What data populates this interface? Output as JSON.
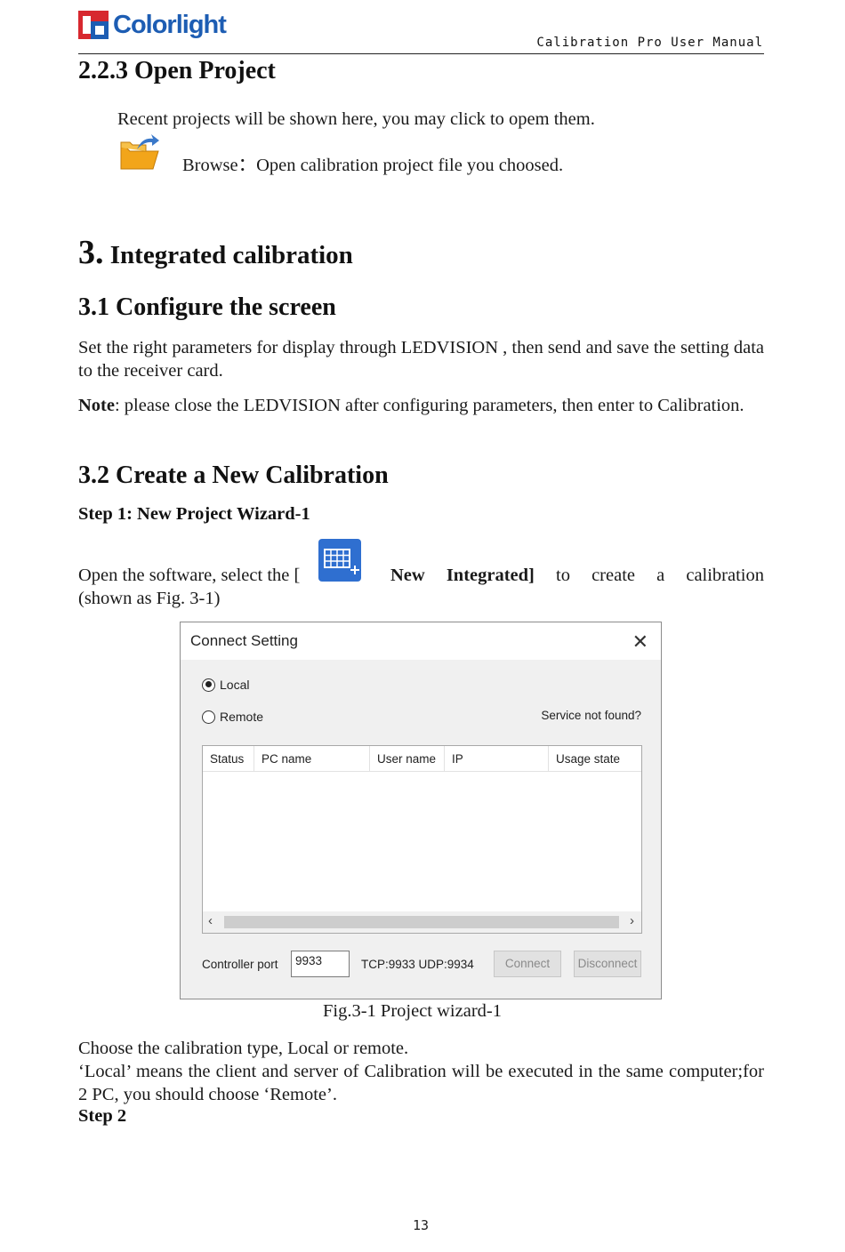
{
  "header": {
    "logo_text": "Colorlight",
    "manual_title": "Calibration Pro User Manual"
  },
  "section_223": {
    "heading": "2.2.3 Open Project",
    "line1": "Recent projects will be shown here, you may click to opem them.",
    "browse_text": "Browse：Open calibration project file you choosed."
  },
  "chapter3": {
    "num": "3.",
    "title": "Integrated calibration"
  },
  "section_31": {
    "heading": "3.1 Configure the screen",
    "para": "Set the right parameters for display through LEDVISION , then send and save the setting data to the receiver card.",
    "note_label": "Note",
    "note_text": ": please close the LEDVISION after configuring parameters, then enter to Calibration."
  },
  "section_32": {
    "heading": "3.2 Create a New Calibration",
    "step1": "Step 1: New Project Wizard-1",
    "open_pre": "Open the software, select the [",
    "open_bold": "New Integrated]",
    "open_post": "to create a calibration",
    "open_line2": "(shown as Fig. 3-1)"
  },
  "dialog": {
    "title": "Connect Setting",
    "close": "✕",
    "radio_local": "Local",
    "radio_remote": "Remote",
    "selected": "Local",
    "service_link": "Service not found?",
    "columns": [
      "Status",
      "PC name",
      "User name",
      "IP",
      "Usage state"
    ],
    "scroll_left": "‹",
    "scroll_right": "›",
    "port_label": "Controller port",
    "port_value": "9933",
    "tcp_info": "TCP:9933 UDP:9934",
    "connect_label": "Connect",
    "disconnect_label": "Disconnect"
  },
  "caption": "Fig.3-1 Project wizard-1",
  "after": {
    "line1": "Choose the calibration type, Local or remote.",
    "line2": "‘Local’ means the client and server of Calibration will be executed in the same computer;for 2 PC, you should choose ‘Remote’.",
    "step2": "Step 2"
  },
  "page_number": "13"
}
